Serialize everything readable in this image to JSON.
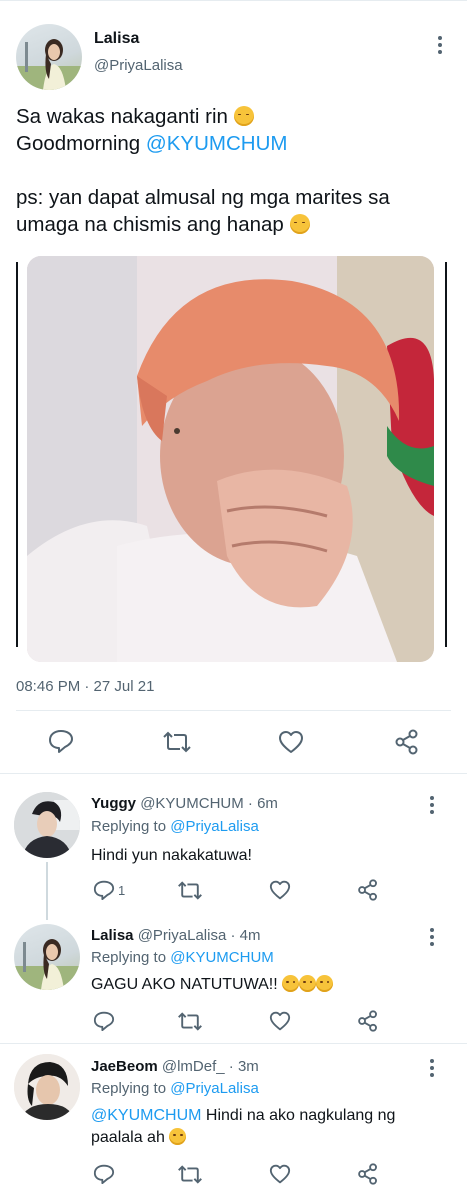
{
  "main_tweet": {
    "author_name": "Lalisa",
    "author_handle": "@PriyaLalisa",
    "text_line1": "Sa wakas nakaganti rin",
    "text_line2_prefix": "Goodmorning",
    "text_line2_mention": "@KYUMCHUM",
    "text_line3": "ps: yan dapat almusal ng mga marites sa",
    "text_line4": "umaga na chismis ang hanap",
    "timestamp": "08:46 PM · 27 Jul 21"
  },
  "replies": [
    {
      "author_name": "Yuggy",
      "author_handle": "@KYUMCHUM",
      "time": "· 6m",
      "replying_label": "Replying to",
      "replying_to": "@PriyaLalisa",
      "text": "Hindi yun nakakatuwa!",
      "reply_count": "1"
    },
    {
      "author_name": "Lalisa",
      "author_handle": "@PriyaLalisa",
      "time": "· 4m",
      "replying_label": "Replying to",
      "replying_to": "@KYUMCHUM",
      "text": "GAGU AKO NATUTUWA!!"
    },
    {
      "author_name": "JaeBeom",
      "author_handle": "@lmDef_",
      "time": "· 3m",
      "replying_label": "Replying to",
      "replying_to": "@PriyaLalisa",
      "text_mention": "@KYUMCHUM",
      "text_line1": "Hindi na ako nagkulang ng",
      "text_line2": "paalala ah"
    }
  ],
  "icons": {
    "reply": "reply-icon",
    "retweet": "retweet-icon",
    "like": "like-icon",
    "share": "share-icon",
    "more": "more-options-icon"
  },
  "colors": {
    "link": "#1d9bf0",
    "muted": "#536471",
    "text": "#0f1419",
    "divider": "#e6ecf0"
  }
}
